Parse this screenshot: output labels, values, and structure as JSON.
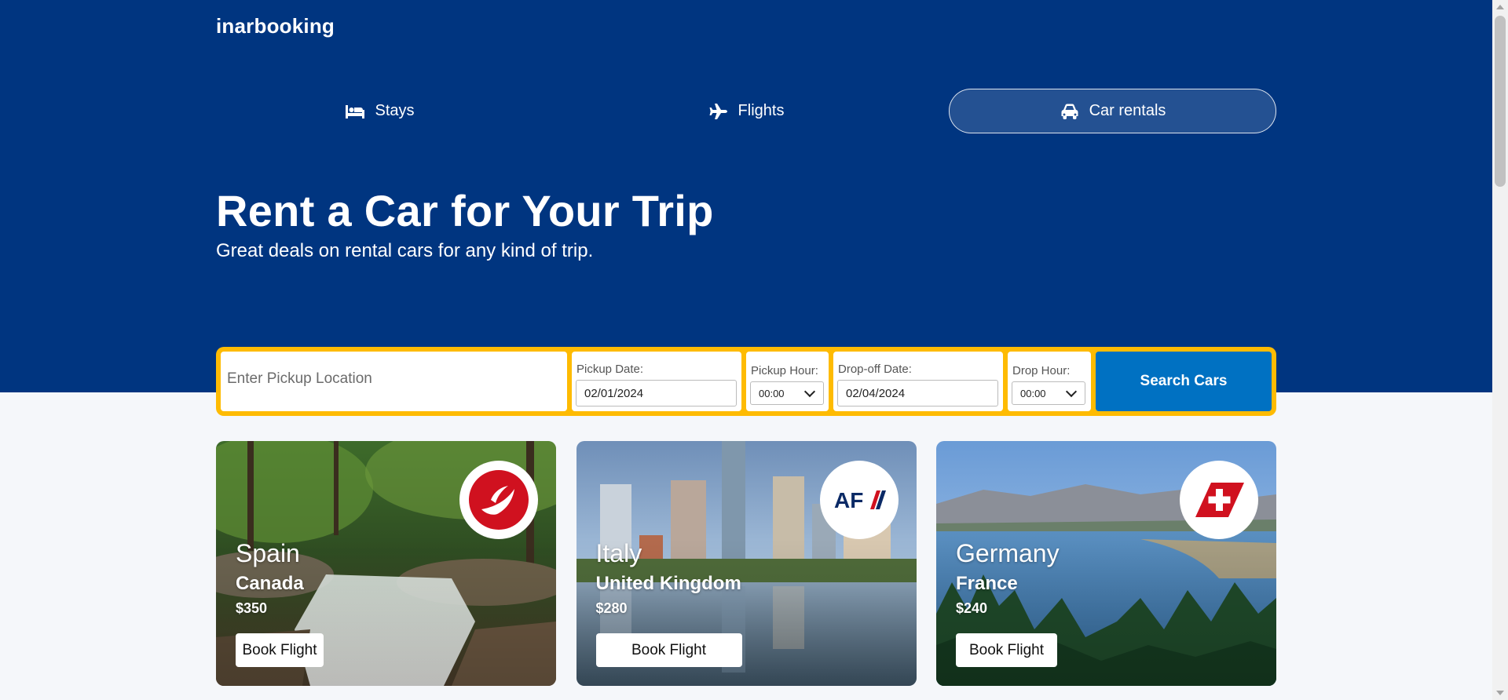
{
  "header": {
    "logo": "inarbooking"
  },
  "tabs": [
    {
      "label": "Stays",
      "icon": "bed-icon",
      "active": false
    },
    {
      "label": "Flights",
      "icon": "plane-icon",
      "active": false
    },
    {
      "label": "Car rentals",
      "icon": "car-icon",
      "active": true
    }
  ],
  "hero": {
    "title": "Rent a Car for Your Trip",
    "subtitle": "Great deals on rental cars for any kind of trip."
  },
  "search": {
    "location_placeholder": "Enter Pickup Location",
    "location_value": "",
    "pickup_date_label": "Pickup Date:",
    "pickup_date_value": "02/01/2024",
    "pickup_hour_label": "Pickup Hour:",
    "pickup_hour_value": "00:00",
    "dropoff_date_label": "Drop-off Date:",
    "dropoff_date_value": "02/04/2024",
    "drop_hour_label": "Drop Hour:",
    "drop_hour_value": "00:00",
    "button_label": "Search Cars"
  },
  "cards": [
    {
      "destination": "Spain",
      "origin": "Canada",
      "price": "$350",
      "button": "Book Flight",
      "airline_logo": "turkish-airlines-logo"
    },
    {
      "destination": "Italy",
      "origin": "United Kingdom",
      "price": "$280",
      "button": "Book Flight",
      "airline_logo": "air-france-logo"
    },
    {
      "destination": "Germany",
      "origin": "France",
      "price": "$240",
      "button": "Book Flight",
      "airline_logo": "swiss-logo"
    }
  ],
  "colors": {
    "hero_bg": "#003580",
    "search_border": "#febb02",
    "search_button": "#0071c2"
  }
}
